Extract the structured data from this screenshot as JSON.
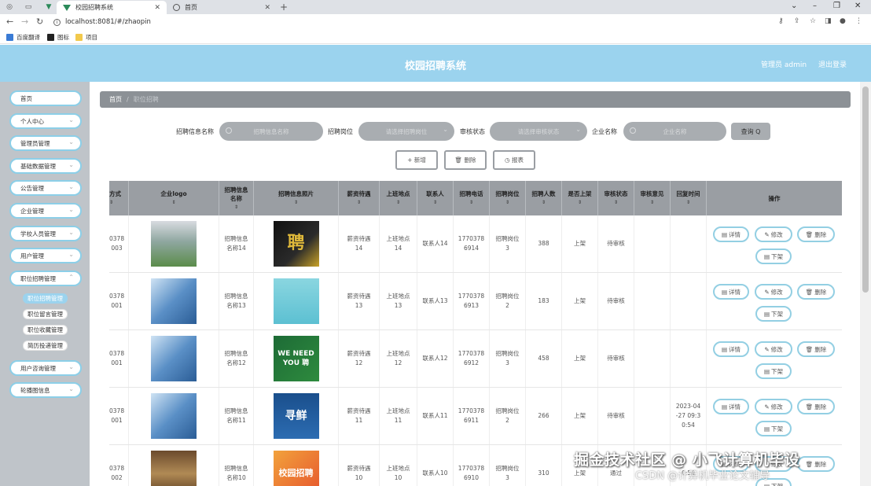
{
  "browser": {
    "tabs": [
      {
        "title": "校园招聘系统",
        "active": true
      },
      {
        "title": "首页",
        "active": false
      }
    ],
    "new_tab": "+",
    "url": "localhost:8081/#/zhaopin",
    "bookmarks": [
      "百度翻译",
      "图标",
      "项目"
    ]
  },
  "header": {
    "title": "校园招聘系统",
    "user": "管理员 admin",
    "logout": "退出登录"
  },
  "sidebar": {
    "items": [
      {
        "label": "首页",
        "expandable": false
      },
      {
        "label": "个人中心",
        "expandable": true
      },
      {
        "label": "管理员管理",
        "expandable": true
      },
      {
        "label": "基础数据管理",
        "expandable": true
      },
      {
        "label": "公告管理",
        "expandable": true
      },
      {
        "label": "企业管理",
        "expandable": true
      },
      {
        "label": "学校人员管理",
        "expandable": true
      },
      {
        "label": "用户管理",
        "expandable": true
      },
      {
        "label": "职位招聘管理",
        "expandable": true
      },
      {
        "label": "用户咨询管理",
        "expandable": true
      },
      {
        "label": "轮播图信息",
        "expandable": true
      }
    ],
    "submenu": [
      "职位招聘管理",
      "职位留言管理",
      "职位收藏管理",
      "简历投递管理"
    ]
  },
  "breadcrumb": {
    "home": "首页",
    "separator": "/",
    "current": "职位招聘"
  },
  "search": {
    "name_label": "招聘信息名称",
    "name_placeholder": "招聘信息名称",
    "position_label": "招聘岗位",
    "position_placeholder": "请选择招聘岗位",
    "status_label": "审核状态",
    "status_placeholder": "请选择审核状态",
    "company_label": "企业名称",
    "company_placeholder": "企业名称",
    "search_button": "查询 Q"
  },
  "actions": {
    "add": "+ 新增",
    "delete": "🗑 删除",
    "report": "◷ 报表"
  },
  "table": {
    "headers": [
      "方式",
      "企业logo",
      "招聘信息名称",
      "招聘信息照片",
      "薪资待遇",
      "上班地点",
      "联系人",
      "招聘电话",
      "招聘岗位",
      "招聘人数",
      "是否上架",
      "审核状态",
      "审核意见",
      "回复时间",
      "操作"
    ],
    "rows": [
      {
        "mode": "0378\n003",
        "name": "招聘信息\n名称14",
        "salary": "薪资待遇\n14",
        "location": "上班地点\n14",
        "contact": "联系人14",
        "phone": "1770378\n6914",
        "position": "招聘岗位\n3",
        "count": "388",
        "listed": "上架",
        "status": "待审核",
        "opinion": "",
        "reply_time": ""
      },
      {
        "mode": "0378\n001",
        "name": "招聘信息\n名称13",
        "salary": "薪资待遇\n13",
        "location": "上班地点\n13",
        "contact": "联系人13",
        "phone": "1770378\n6913",
        "position": "招聘岗位\n2",
        "count": "183",
        "listed": "上架",
        "status": "待审核",
        "opinion": "",
        "reply_time": ""
      },
      {
        "mode": "0378\n001",
        "name": "招聘信息\n名称12",
        "salary": "薪资待遇\n12",
        "location": "上班地点\n12",
        "contact": "联系人12",
        "phone": "1770378\n6912",
        "position": "招聘岗位\n3",
        "count": "458",
        "listed": "上架",
        "status": "待审核",
        "opinion": "",
        "reply_time": ""
      },
      {
        "mode": "0378\n001",
        "name": "招聘信息\n名称11",
        "salary": "薪资待遇\n11",
        "location": "上班地点\n11",
        "contact": "联系人11",
        "phone": "1770378\n6911",
        "position": "招聘岗位\n2",
        "count": "266",
        "listed": "上架",
        "status": "待审核",
        "opinion": "",
        "reply_time": "2023-04\n-27 09:3\n0:54"
      },
      {
        "mode": "0378\n002",
        "name": "招聘信息\n名称10",
        "salary": "薪资待遇\n10",
        "location": "上班地点\n10",
        "contact": "联系人10",
        "phone": "1770378\n6910",
        "position": "招聘岗位\n3",
        "count": "310",
        "listed": "上架",
        "status": "通过",
        "opinion": "",
        "reply_time": "0:54"
      }
    ],
    "op_buttons": {
      "detail": "详情",
      "edit": "修改",
      "delete": "删除",
      "unlist": "下架"
    }
  },
  "photo_texts": [
    "聘",
    "",
    "WE NEED YOU 聘",
    "寻鲜",
    "校园招聘"
  ],
  "watermark": "掘金技术社区 @ 小飞计算机毕设",
  "watermark2": "CSDN @计算机毕业论文辅导",
  "colors": {
    "accent": "#9bd3ee",
    "header_bg": "#9bd3ee",
    "sidebar_bg": "#bfc4c9",
    "table_head": "#9a9ea3",
    "button_border": "#93cfe3"
  }
}
